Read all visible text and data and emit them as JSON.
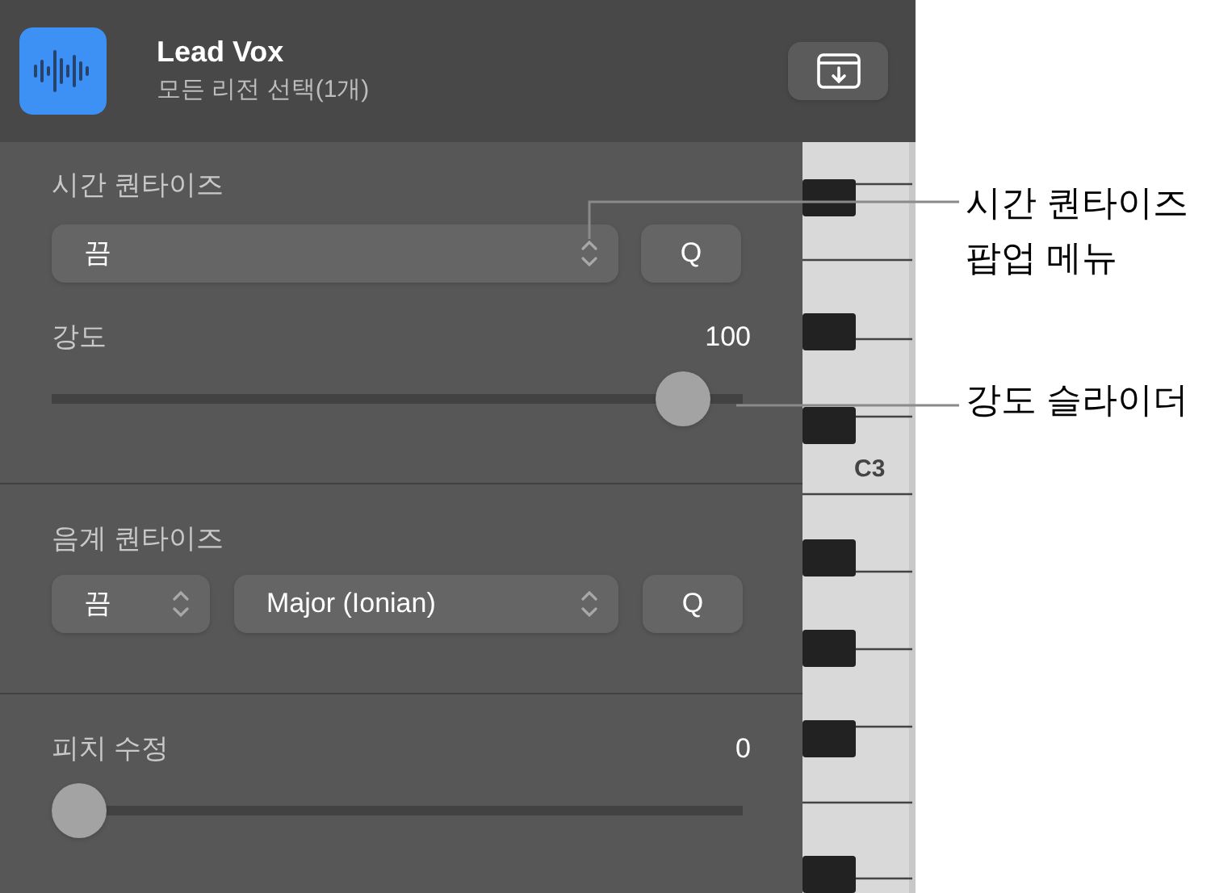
{
  "header": {
    "title": "Lead Vox",
    "subtitle": "모든 리전 선택(1개)"
  },
  "time_quantize": {
    "title": "시간 퀀타이즈",
    "popup": {
      "value": "끔"
    },
    "q_button": "Q"
  },
  "strength": {
    "label": "강도",
    "value": "100",
    "level": 0.95
  },
  "scale_quantize": {
    "title": "음계 퀀타이즈",
    "popups": [
      {
        "value": "끔"
      },
      {
        "value": "Major (Ionian)"
      }
    ],
    "q_button": "Q"
  },
  "pitch_correction": {
    "label": "피치 수정",
    "value": "0",
    "level": 0
  },
  "piano": {
    "note_label": "C3"
  },
  "callouts": [
    {
      "text": "시간 퀀타이즈\n팝업 메뉴"
    },
    {
      "text": "강도 슬라이더"
    }
  ]
}
